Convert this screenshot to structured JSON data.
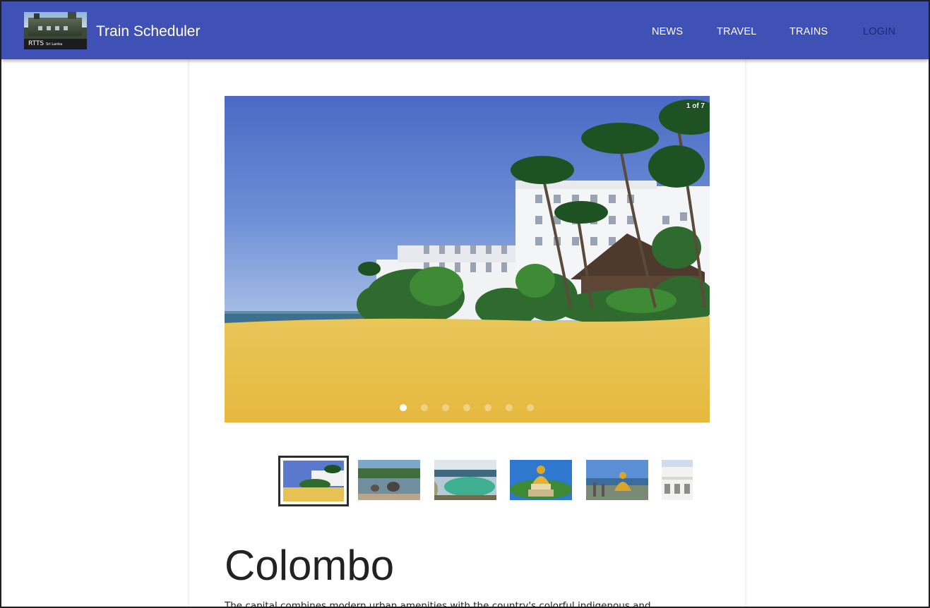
{
  "header": {
    "brand": "Train Scheduler",
    "logo_caption": "RTTS",
    "logo_caption_small": "Sri Lanka",
    "nav": [
      {
        "label": "NEWS"
      },
      {
        "label": "TRAVEL"
      },
      {
        "label": "TRAINS"
      },
      {
        "label": "LOGIN"
      }
    ],
    "colors": {
      "appbar": "#3f51b5",
      "nav_text": "#ffffff",
      "login_text": "#1d2a7a"
    }
  },
  "gallery": {
    "counter": "1 of 7",
    "current_slide": 1,
    "total_slides": 7,
    "thumbnails": [
      {
        "icon": "beach-hotel-thumbnail",
        "selected": true
      },
      {
        "icon": "elephants-river-thumbnail",
        "selected": false
      },
      {
        "icon": "coastal-lagoon-thumbnail",
        "selected": false
      },
      {
        "icon": "golden-buddha-thumbnail",
        "selected": false
      },
      {
        "icon": "buddha-statue-lake-thumbnail",
        "selected": false
      },
      {
        "icon": "white-building-thumbnail",
        "selected": false
      }
    ]
  },
  "article": {
    "title": "Colombo",
    "description": "The capital combines modern urban amenities with the country's colorful indigenous and"
  }
}
